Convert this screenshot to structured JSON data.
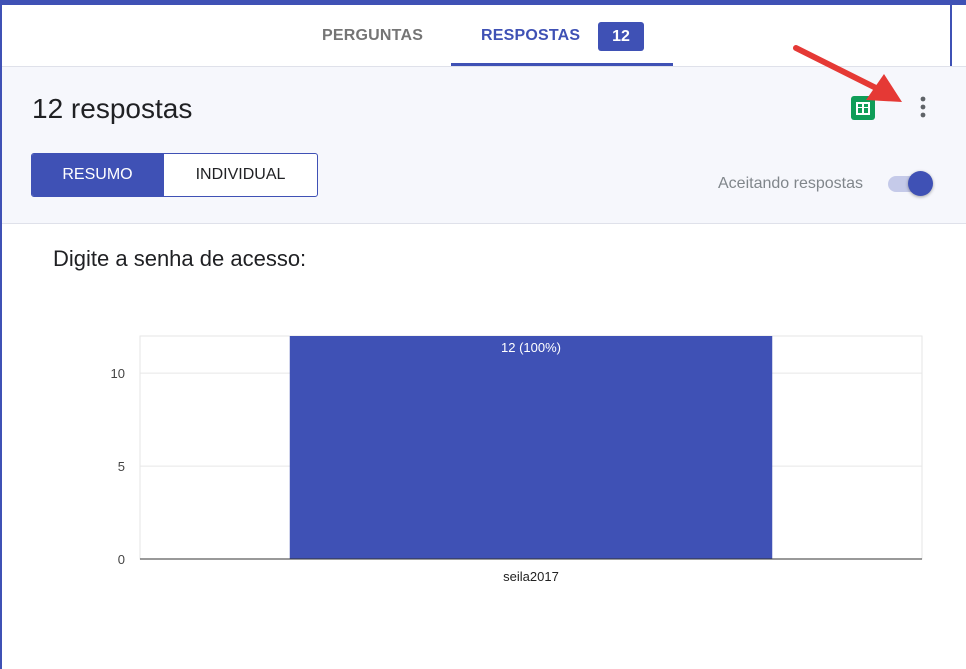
{
  "tabs": {
    "perguntas_label": "PERGUNTAS",
    "respostas_label": "RESPOSTAS",
    "respostas_count": "12"
  },
  "header": {
    "responses_title": "12 respostas",
    "view_toggle": {
      "resumo_label": "RESUMO",
      "individual_label": "INDIVIDUAL",
      "selected": "RESUMO"
    },
    "accepting_label": "Aceitando respostas",
    "accepting_on": true,
    "icons": [
      "sheets-icon",
      "more-vert-icon"
    ]
  },
  "question": {
    "title": "Digite a senha de acesso:"
  },
  "chart_data": {
    "type": "bar",
    "categories": [
      "seila2017"
    ],
    "values": [
      12
    ],
    "data_labels": [
      "12 (100%)"
    ],
    "ylim": [
      0,
      12
    ],
    "yticks": [
      0,
      5,
      10
    ],
    "grid": true,
    "bar_color": "#3f51b5"
  },
  "colors": {
    "accent": "#3f51b5",
    "sheets_green": "#0f9d58",
    "annotation_red": "#e53935"
  }
}
